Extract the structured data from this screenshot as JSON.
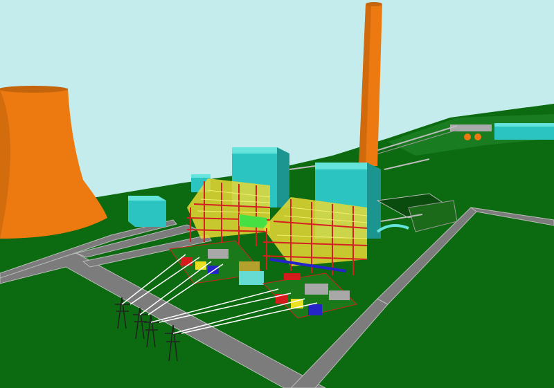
{
  "scene": {
    "colors": {
      "sky": "#c4ecec",
      "ground": "#0c6a10",
      "road": "#7c7c7c",
      "road_edge": "#bcbcbc",
      "tower": "#ec7a10",
      "tower_shade": "#b45a0a",
      "building": "#2cc4c0",
      "building_shade": "#1c9490",
      "roof": "#64e4dc",
      "frame_red": "#d42020",
      "frame_yellow": "#e8d834",
      "equip_blue": "#2424c8",
      "equip_red": "#d41c1c",
      "equip_yellow": "#e8e020",
      "equip_gray": "#a8a8a8",
      "pylon": "#202020",
      "wire": "#ffffff"
    }
  }
}
